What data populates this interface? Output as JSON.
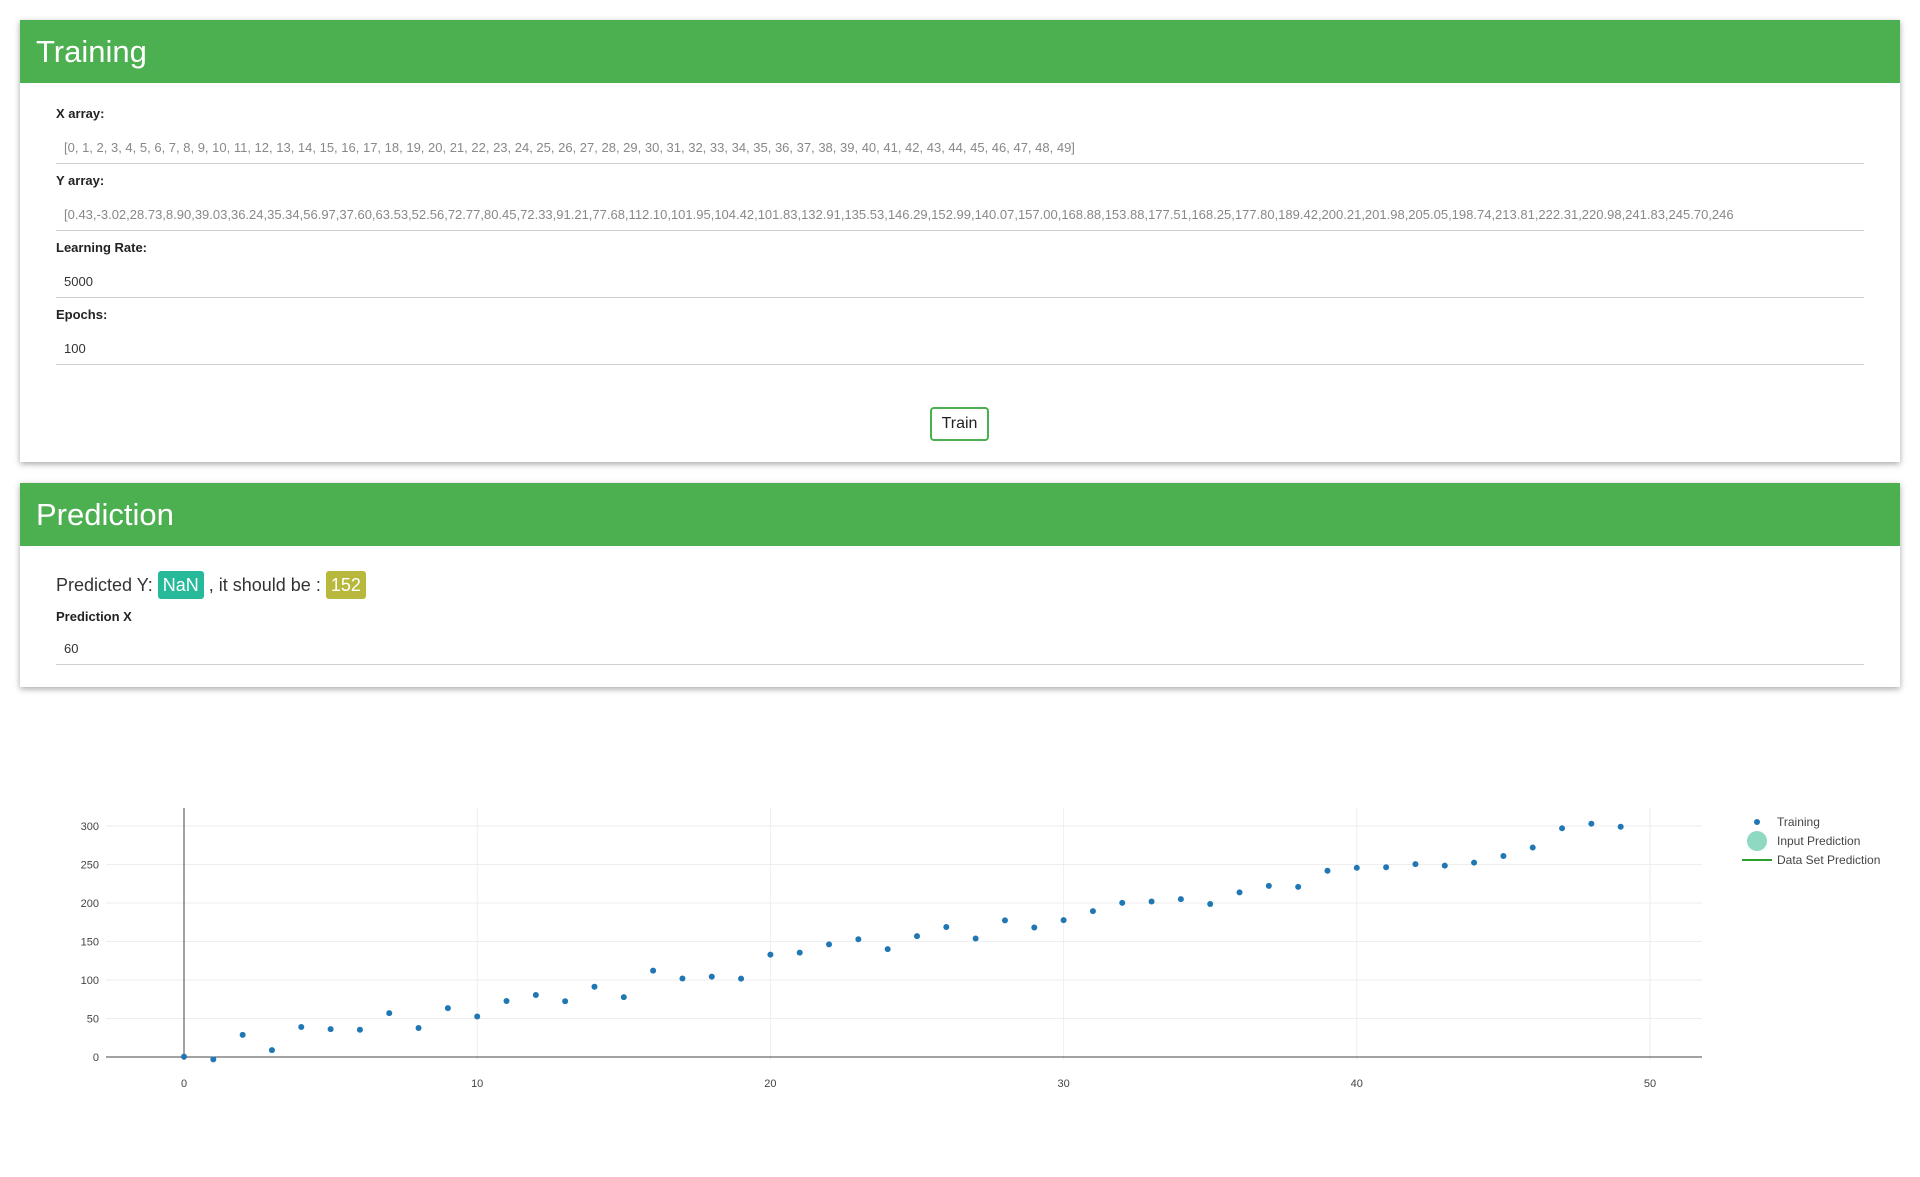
{
  "training": {
    "title": "Training",
    "x_label": "X array:",
    "x_value": "[0, 1, 2, 3, 4, 5, 6, 7, 8, 9, 10, 11, 12, 13, 14, 15, 16, 17, 18, 19, 20, 21, 22, 23, 24, 25,    26, 27, 28, 29, 30, 31, 32, 33, 34, 35, 36, 37, 38, 39, 40, 41, 42, 43, 44, 45, 46, 47, 48, 49]",
    "y_label": "Y array:",
    "y_value": "[0.43,-3.02,28.73,8.90,39.03,36.24,35.34,56.97,37.60,63.53,52.56,72.77,80.45,72.33,91.21,77.68,112.10,101.95,104.42,101.83,132.91,135.53,146.29,152.99,140.07,157.00,168.88,153.88,177.51,168.25,177.80,189.42,200.21,201.98,205.05,198.74,213.81,222.31,220.98,241.83,245.70,246",
    "lr_label": "Learning Rate:",
    "lr_value": "5000",
    "epochs_label": "Epochs:",
    "epochs_value": "100",
    "train_button": "Train"
  },
  "prediction": {
    "title": "Prediction",
    "predicted_prefix": "Predicted Y:",
    "predicted_value": "NaN",
    "should_be_text": ", it should be :",
    "should_be_value": "152",
    "x_label": "Prediction X",
    "x_value": "60"
  },
  "chart_data": {
    "type": "scatter",
    "xlim": [
      -2.5,
      52
    ],
    "ylim": [
      -5,
      320
    ],
    "x_ticks": [
      0,
      10,
      20,
      30,
      40,
      50
    ],
    "y_ticks": [
      0,
      50,
      100,
      150,
      200,
      250,
      300
    ],
    "grid": true,
    "legend_position": "right",
    "legend": [
      {
        "name": "Training",
        "kind": "marker",
        "color": "#1f77b4"
      },
      {
        "name": "Input Prediction",
        "kind": "big-marker",
        "color": "#8fd9c3"
      },
      {
        "name": "Data Set Prediction",
        "kind": "line",
        "color": "#2ca02c"
      }
    ],
    "series": [
      {
        "name": "Training",
        "color": "#1f77b4",
        "x": [
          0,
          1,
          2,
          3,
          4,
          5,
          6,
          7,
          8,
          9,
          10,
          11,
          12,
          13,
          14,
          15,
          16,
          17,
          18,
          19,
          20,
          21,
          22,
          23,
          24,
          25,
          26,
          27,
          28,
          29,
          30,
          31,
          32,
          33,
          34,
          35,
          36,
          37,
          38,
          39,
          40,
          41,
          42,
          43,
          44,
          45,
          46,
          47,
          48,
          49
        ],
        "y": [
          0.43,
          -3.02,
          28.73,
          8.9,
          39.03,
          36.24,
          35.34,
          56.97,
          37.6,
          63.53,
          52.56,
          72.77,
          80.45,
          72.33,
          91.21,
          77.68,
          112.1,
          101.95,
          104.42,
          101.83,
          132.91,
          135.53,
          146.29,
          152.99,
          140.07,
          157.0,
          168.88,
          153.88,
          177.51,
          168.25,
          177.8,
          189.42,
          200.21,
          201.98,
          205.05,
          198.74,
          213.81,
          222.31,
          220.98,
          241.83,
          245.7,
          246.5,
          250.5,
          248.5,
          252.5,
          261,
          272,
          297,
          303,
          299
        ]
      }
    ]
  }
}
